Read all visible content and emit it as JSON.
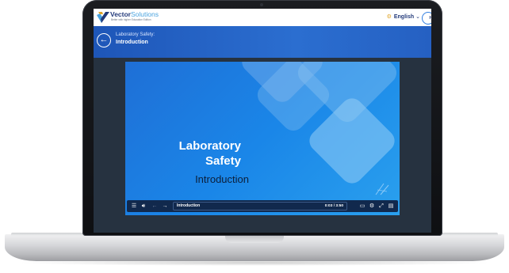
{
  "topbar": {
    "brand": "Vector",
    "brand_light": "Solutions",
    "brand_sub": "Better with higher Education Edition",
    "language": "English",
    "avatar": "Hi"
  },
  "course": {
    "title": "Laboratory Safety:",
    "subtitle": "Introduction"
  },
  "video": {
    "title_line1": "Laboratory",
    "title_line2": "Safety",
    "subtitle": "Introduction"
  },
  "player": {
    "chapter": "Introduction",
    "time": "0:03 / 3:50"
  },
  "icons": {
    "back": "arrow-left-icon",
    "globe": "globe-icon",
    "menu": "menu-icon",
    "volume": "volume-icon",
    "prev": "arrow-left-icon",
    "next": "arrow-right-icon",
    "captions": "captions-icon",
    "settings": "gear-icon",
    "fullscreen": "expand-icon",
    "transcript": "transcript-icon"
  },
  "colors": {
    "header_blue": "#2b6ed0",
    "player_blue": "#1f72d6",
    "control_bar": "#11294d",
    "brand_navy": "#233a7a",
    "brand_light": "#4aa3df"
  }
}
